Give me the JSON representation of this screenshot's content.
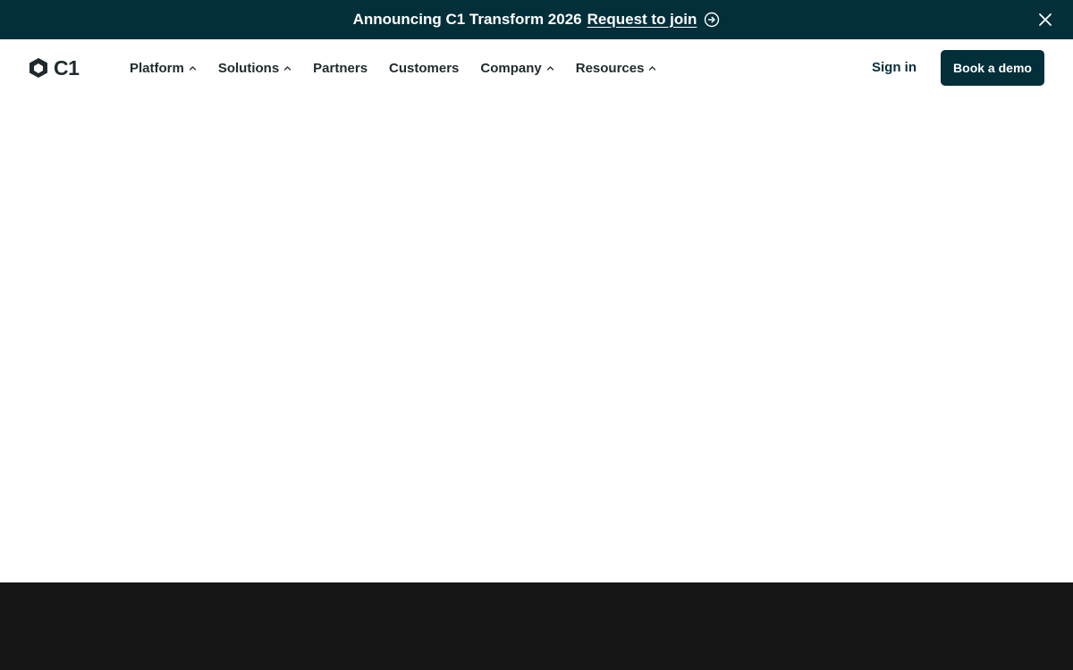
{
  "banner": {
    "text": "Announcing C1 Transform 2026",
    "link_label": "Request to join",
    "link_icon": "arrow-right-circle-icon",
    "close_icon": "close-icon",
    "background": "#022f3a"
  },
  "header": {
    "logo_text": "C1",
    "logo_icon": "c1-logo-mark",
    "nav": [
      {
        "label": "Platform",
        "has_dropdown": true
      },
      {
        "label": "Solutions",
        "has_dropdown": true
      },
      {
        "label": "Partners",
        "has_dropdown": false
      },
      {
        "label": "Customers",
        "has_dropdown": false
      },
      {
        "label": "Company",
        "has_dropdown": true
      },
      {
        "label": "Resources",
        "has_dropdown": true
      }
    ],
    "sign_in_label": "Sign in",
    "demo_label": "Book a demo",
    "accent": "#022f3a"
  },
  "footer_band": {
    "background": "#161616"
  }
}
